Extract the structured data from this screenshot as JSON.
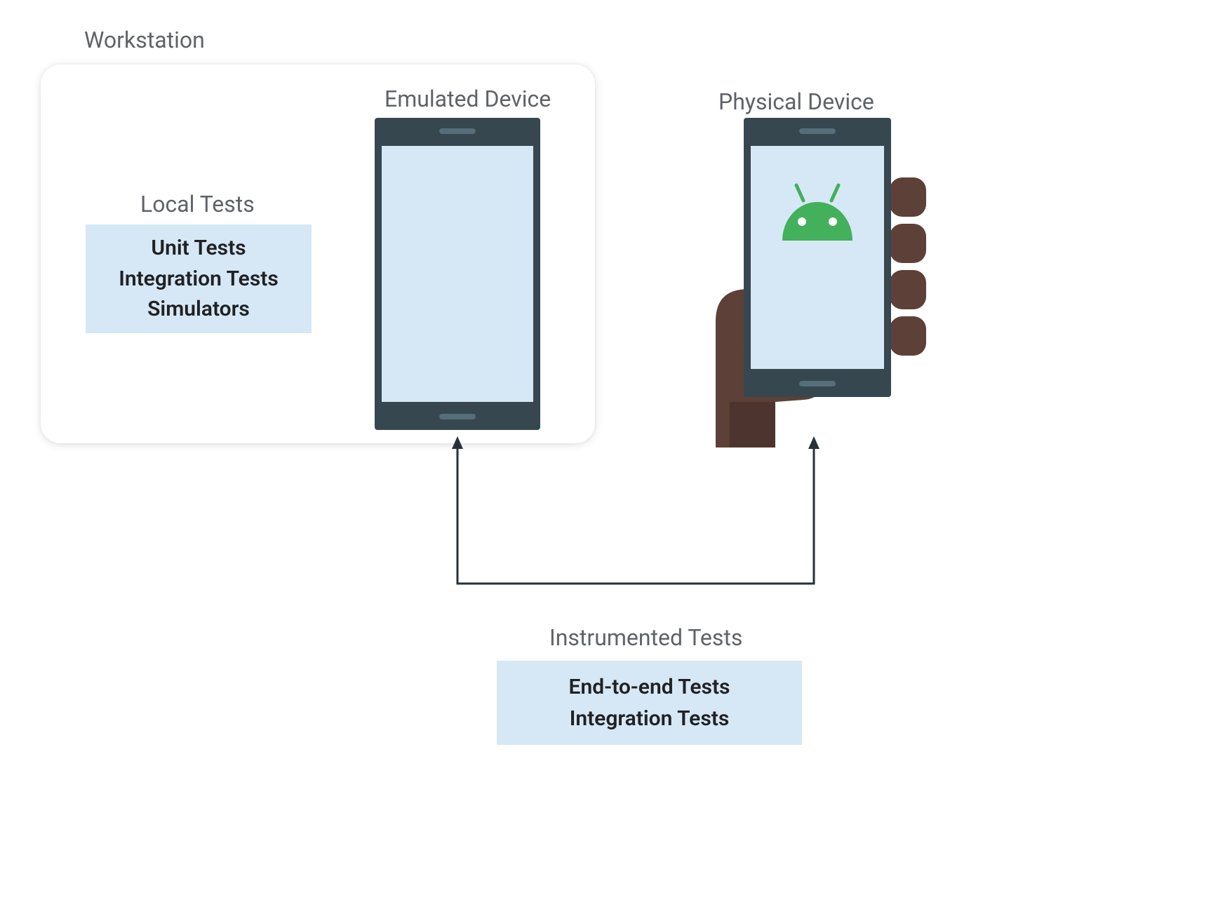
{
  "labels": {
    "workstation": "Workstation",
    "emulated": "Emulated Device",
    "local_tests": "Local Tests",
    "physical": "Physical Device",
    "instrumented": "Instrumented Tests"
  },
  "local_tests_box": {
    "line1": "Unit Tests",
    "line2": "Integration Tests",
    "line3": "Simulators"
  },
  "instrumented_box": {
    "line1": "End-to-end Tests",
    "line2": "Integration Tests"
  },
  "colors": {
    "label_gray": "#5f6368",
    "box_blue": "#d6e8f5",
    "phone_dark": "#37474f",
    "android_green": "#3ddc84",
    "hand_brown": "#5d4037",
    "hand_brown_dark": "#4e342e",
    "arrow": "#263238"
  }
}
